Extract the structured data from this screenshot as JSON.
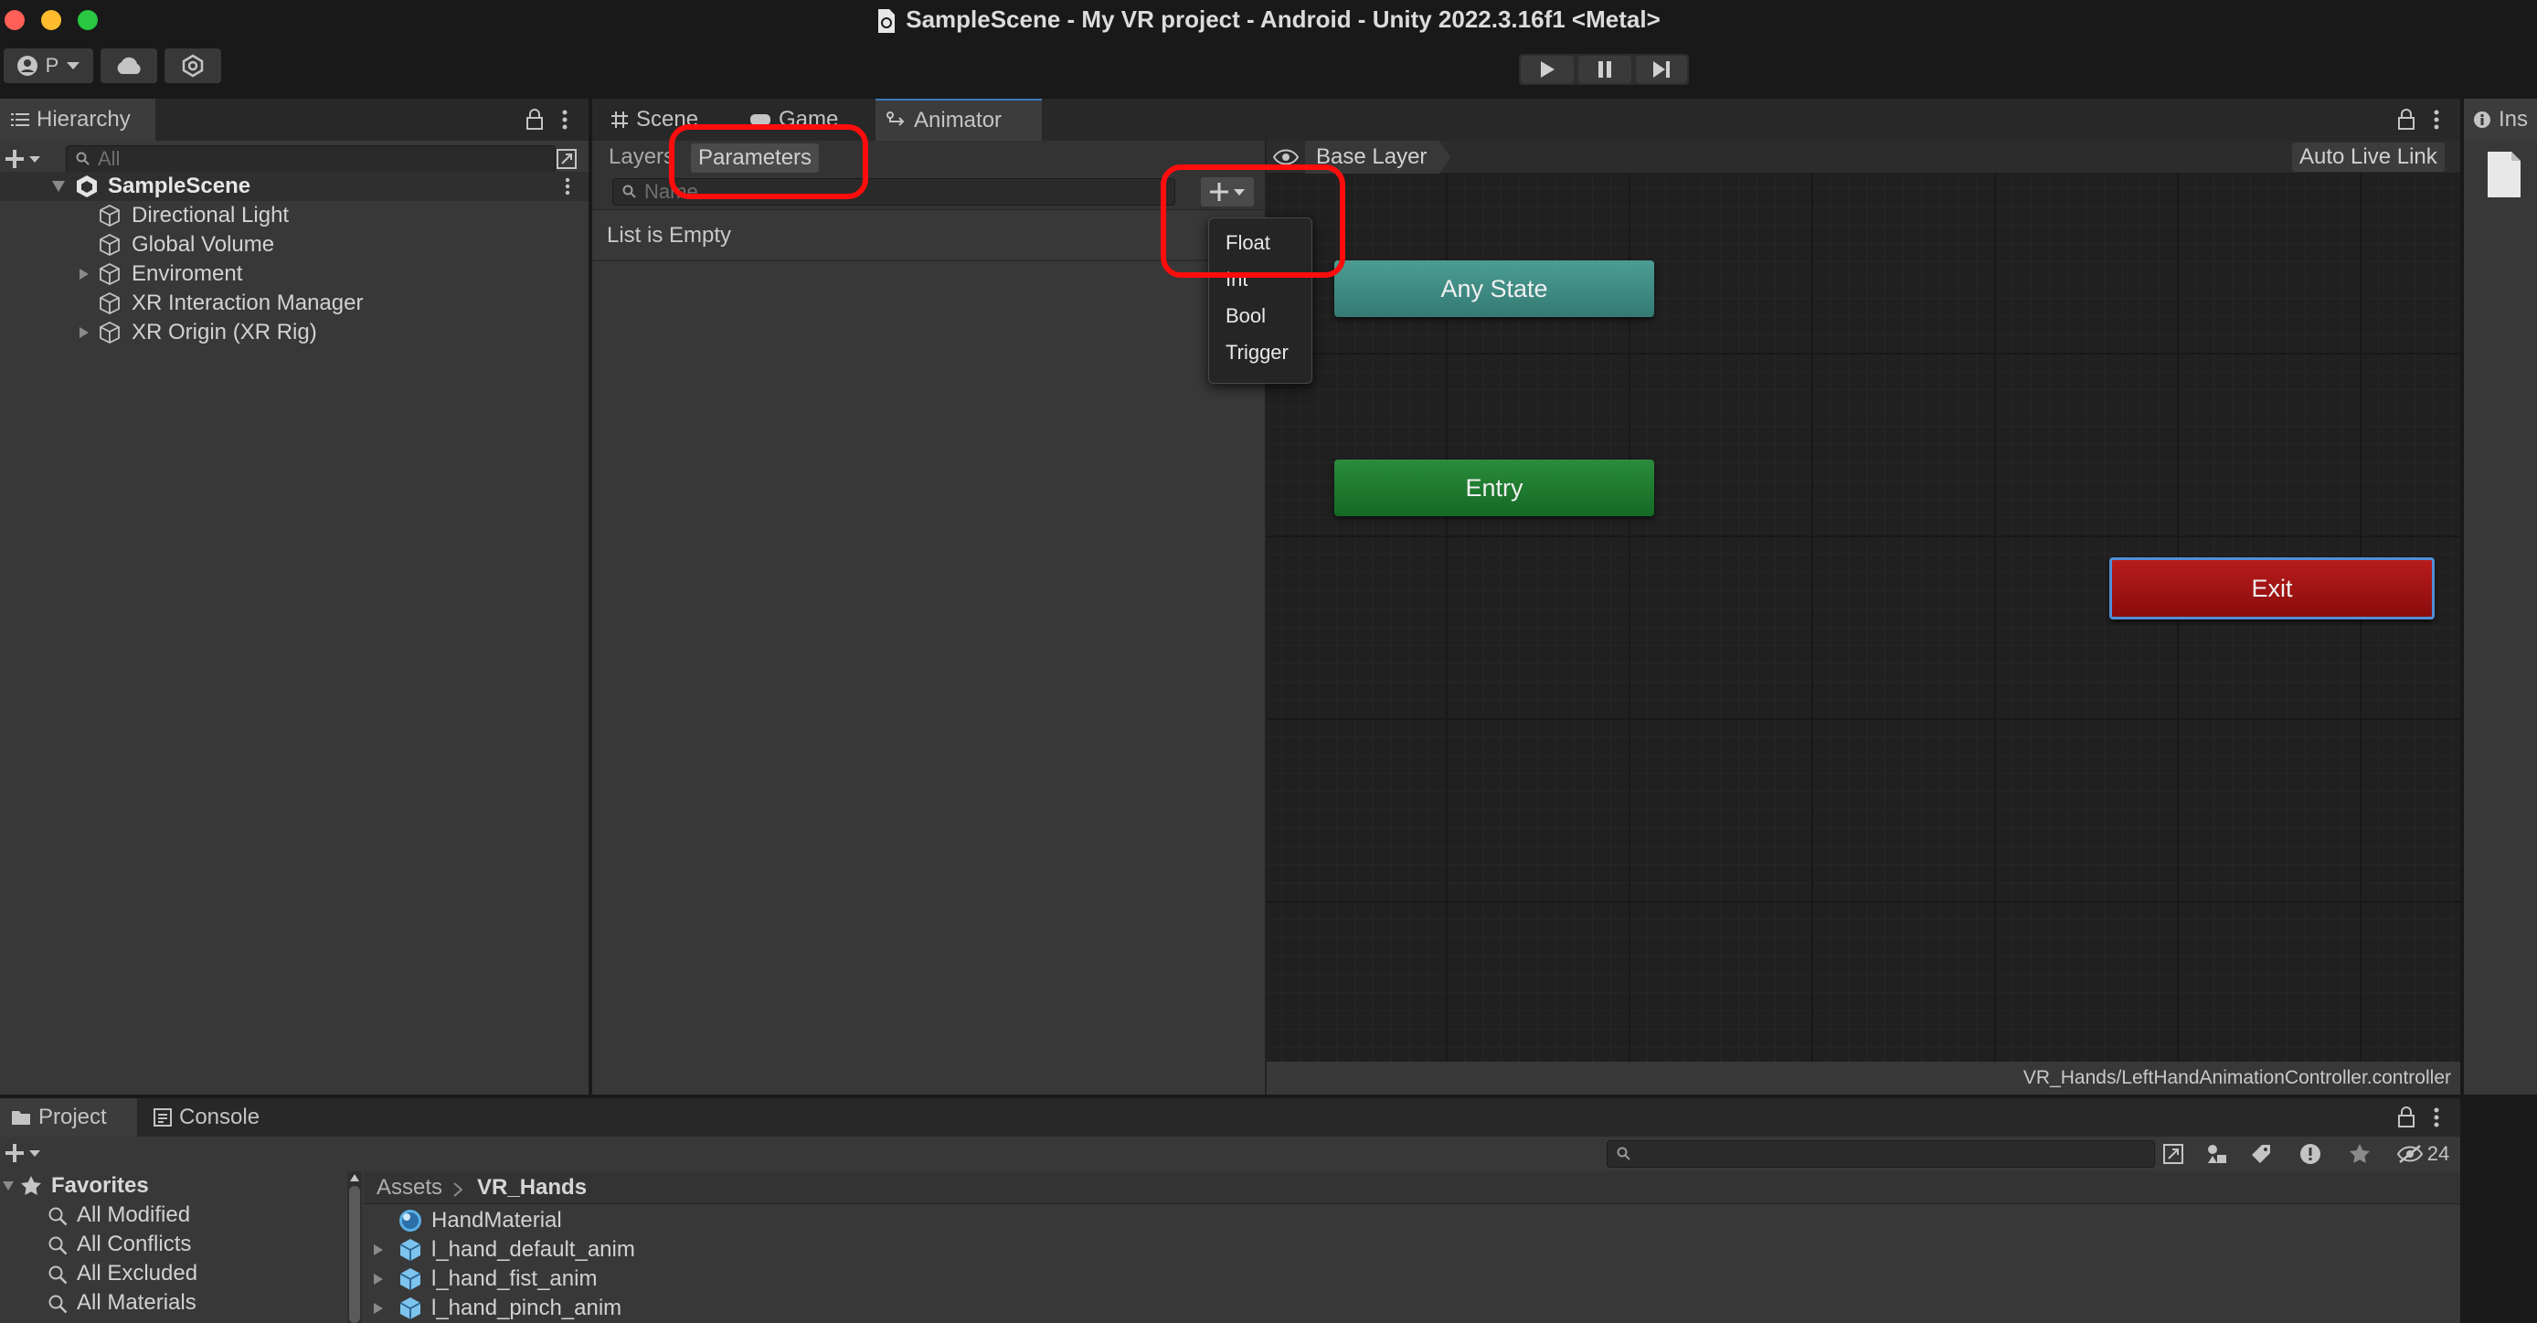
{
  "window": {
    "title": "SampleScene - My VR project - Android - Unity 2022.3.16f1 <Metal>"
  },
  "toolbar": {
    "account_label": "P",
    "icons": [
      "account-icon",
      "cloud-icon",
      "collab-icon",
      "play-icon",
      "pause-icon",
      "step-icon"
    ]
  },
  "hierarchy": {
    "tab_label": "Hierarchy",
    "search_placeholder": "All",
    "scene_name": "SampleScene",
    "items": [
      {
        "label": "Directional Light",
        "expandable": false
      },
      {
        "label": "Global Volume",
        "expandable": false
      },
      {
        "label": "Enviroment",
        "expandable": true
      },
      {
        "label": "XR Interaction Manager",
        "expandable": false
      },
      {
        "label": "XR Origin (XR Rig)",
        "expandable": true
      }
    ]
  },
  "center_tabs": {
    "scene": "Scene",
    "game": "Game",
    "animator": "Animator"
  },
  "animator": {
    "layers_tab": "Layers",
    "parameters_tab": "Parameters",
    "name_placeholder": "Name",
    "empty_text": "List is Empty",
    "breadcrumb": "Base Layer",
    "auto_live_link": "Auto Live Link",
    "add_menu": [
      "Float",
      "Int",
      "Bool",
      "Trigger"
    ],
    "states": {
      "any_state": "Any State",
      "entry": "Entry",
      "exit": "Exit"
    },
    "controller_path": "VR_Hands/LeftHandAnimationController.controller",
    "colors": {
      "any_state": "#3e8a82",
      "entry": "#1c7a2e",
      "exit": "#a31414",
      "highlight": "#ff0d0d"
    }
  },
  "inspector": {
    "tab_label": "Ins"
  },
  "project": {
    "project_tab": "Project",
    "console_tab": "Console",
    "hidden_count": "24",
    "favorites_label": "Favorites",
    "favorites": [
      "All Modified",
      "All Conflicts",
      "All Excluded",
      "All Materials"
    ],
    "breadcrumb_root": "Assets",
    "breadcrumb_folder": "VR_Hands",
    "assets": [
      {
        "label": "HandMaterial",
        "type": "material"
      },
      {
        "label": "l_hand_default_anim",
        "type": "model"
      },
      {
        "label": "l_hand_fist_anim",
        "type": "model"
      },
      {
        "label": "l_hand_pinch_anim",
        "type": "model"
      }
    ]
  }
}
